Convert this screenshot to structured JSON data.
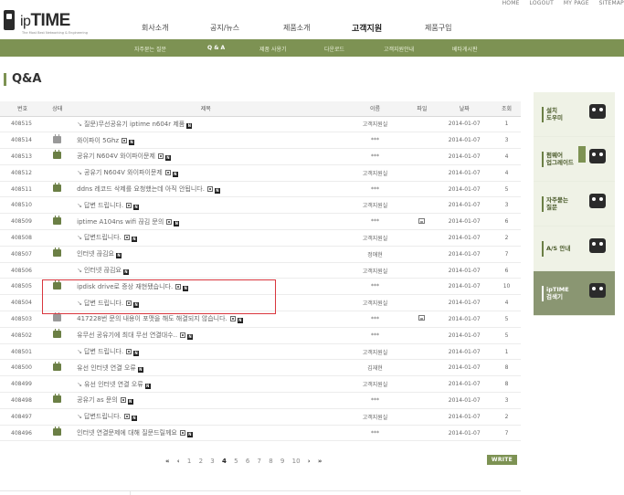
{
  "top_links": [
    "HOME",
    "LOGOUT",
    "MY PAGE",
    "SITEMAP"
  ],
  "logo": {
    "text_ip": "ip",
    "text_time": "TIME",
    "sub": "The Most Best Networking & Engineering"
  },
  "main_nav": [
    "회사소개",
    "공지/뉴스",
    "제품소개",
    "고객지원",
    "제품구입"
  ],
  "main_nav_active": "고객지원",
  "sub_nav": [
    "자주묻는 질문",
    "Q & A",
    "제품 사용기",
    "다운로드",
    "고객지원안내",
    "베타게시판"
  ],
  "sub_nav_active": "Q & A",
  "page_title": "Q&A",
  "table": {
    "headers": [
      "번호",
      "상태",
      "제목",
      "이름",
      "파일",
      "날짜",
      "조회"
    ],
    "rows": [
      {
        "num": "408515",
        "status": "",
        "reply": true,
        "title": "질문)무선공유기 iptime n604r 제품",
        "attach": false,
        "name": "고객지원실",
        "file": false,
        "date": "2014-01-07",
        "views": "1"
      },
      {
        "num": "408514",
        "status": "gray",
        "reply": false,
        "title": "와이파이 5Ghz",
        "attach": true,
        "name": "***",
        "file": false,
        "date": "2014-01-07",
        "views": "3"
      },
      {
        "num": "408513",
        "status": "green",
        "reply": false,
        "title": "공유기 N604V 와이파이문제",
        "attach": true,
        "name": "***",
        "file": false,
        "date": "2014-01-07",
        "views": "4"
      },
      {
        "num": "408512",
        "status": "",
        "reply": true,
        "title": "공유기 N604V 와이파이문제",
        "attach": true,
        "name": "고객지원실",
        "file": false,
        "date": "2014-01-07",
        "views": "4"
      },
      {
        "num": "408511",
        "status": "green",
        "reply": false,
        "title": "ddns 레코드 삭제를 요청했는데 아직 안됩니다.",
        "attach": true,
        "name": "***",
        "file": false,
        "date": "2014-01-07",
        "views": "5"
      },
      {
        "num": "408510",
        "status": "",
        "reply": true,
        "title": "답변 드립니다.",
        "attach": true,
        "name": "고객지원실",
        "file": false,
        "date": "2014-01-07",
        "views": "3"
      },
      {
        "num": "408509",
        "status": "green",
        "reply": false,
        "title": "iptime A104ns wifi 끊김 문의",
        "attach": true,
        "name": "***",
        "file": true,
        "date": "2014-01-07",
        "views": "6"
      },
      {
        "num": "408508",
        "status": "",
        "reply": true,
        "title": "답변드립니다.",
        "attach": true,
        "name": "고객지원실",
        "file": false,
        "date": "2014-01-07",
        "views": "2"
      },
      {
        "num": "408507",
        "status": "green",
        "reply": false,
        "title": "인터넷 끊김요",
        "attach": false,
        "name": "정애현",
        "file": false,
        "date": "2014-01-07",
        "views": "7"
      },
      {
        "num": "408506",
        "status": "",
        "reply": true,
        "title": "인터넷 끊김요",
        "attach": false,
        "name": "고객지원실",
        "file": false,
        "date": "2014-01-07",
        "views": "6"
      },
      {
        "num": "408505",
        "status": "green",
        "reply": false,
        "title": "ipdisk drive로 증상 재현됐습니다.",
        "attach": true,
        "name": "***",
        "file": false,
        "date": "2014-01-07",
        "views": "10"
      },
      {
        "num": "408504",
        "status": "",
        "reply": true,
        "title": "답변 드립니다.",
        "attach": true,
        "name": "고객지원실",
        "file": false,
        "date": "2014-01-07",
        "views": "4"
      },
      {
        "num": "408503",
        "status": "gray",
        "reply": false,
        "title": "417228번 문의 내용이 포맷을 해도 해결되지 않습니다.",
        "attach": true,
        "name": "***",
        "file": true,
        "date": "2014-01-07",
        "views": "5"
      },
      {
        "num": "408502",
        "status": "green",
        "reply": false,
        "title": "유무선 공유기에 최대 무선 연결대수..",
        "attach": true,
        "name": "***",
        "file": false,
        "date": "2014-01-07",
        "views": "5"
      },
      {
        "num": "408501",
        "status": "",
        "reply": true,
        "title": "답변 드립니다.",
        "attach": true,
        "name": "고객지원실",
        "file": false,
        "date": "2014-01-07",
        "views": "1"
      },
      {
        "num": "408500",
        "status": "green",
        "reply": false,
        "title": "유선 인터넷 연결 오류",
        "attach": false,
        "name": "김재현",
        "file": false,
        "date": "2014-01-07",
        "views": "8"
      },
      {
        "num": "408499",
        "status": "",
        "reply": true,
        "title": "유선 인터넷 연결 오류",
        "attach": false,
        "name": "고객지원실",
        "file": false,
        "date": "2014-01-07",
        "views": "8"
      },
      {
        "num": "408498",
        "status": "green",
        "reply": false,
        "title": "공유기 as 문의",
        "attach": true,
        "name": "***",
        "file": false,
        "date": "2014-01-07",
        "views": "3"
      },
      {
        "num": "408497",
        "status": "",
        "reply": true,
        "title": "답변드립니다.",
        "attach": true,
        "name": "고객지원실",
        "file": false,
        "date": "2014-01-07",
        "views": "2"
      },
      {
        "num": "408496",
        "status": "green",
        "reply": false,
        "title": "인터넷 연결문제에 대해 질문드릴께요",
        "attach": true,
        "name": "***",
        "file": false,
        "date": "2014-01-07",
        "views": "7"
      }
    ]
  },
  "pagination": {
    "pages": [
      "1",
      "2",
      "3",
      "4",
      "5",
      "6",
      "7",
      "8",
      "9",
      "10"
    ],
    "current": "4",
    "first": "«",
    "prev": "‹",
    "next": "›",
    "last": "»"
  },
  "write_button": "WRITE",
  "sidebar": [
    {
      "label1": "설치",
      "label2": "도우미"
    },
    {
      "label1": "펌웨어",
      "label2": "업그레이드"
    },
    {
      "label1": "자주묻는",
      "label2": "질문"
    },
    {
      "label1": "A/S 안내",
      "label2": ""
    },
    {
      "label1": "ipTIME",
      "label2": "검색기"
    }
  ],
  "colors": {
    "accent": "#7d9253",
    "highlight_box": "#d9363e"
  }
}
